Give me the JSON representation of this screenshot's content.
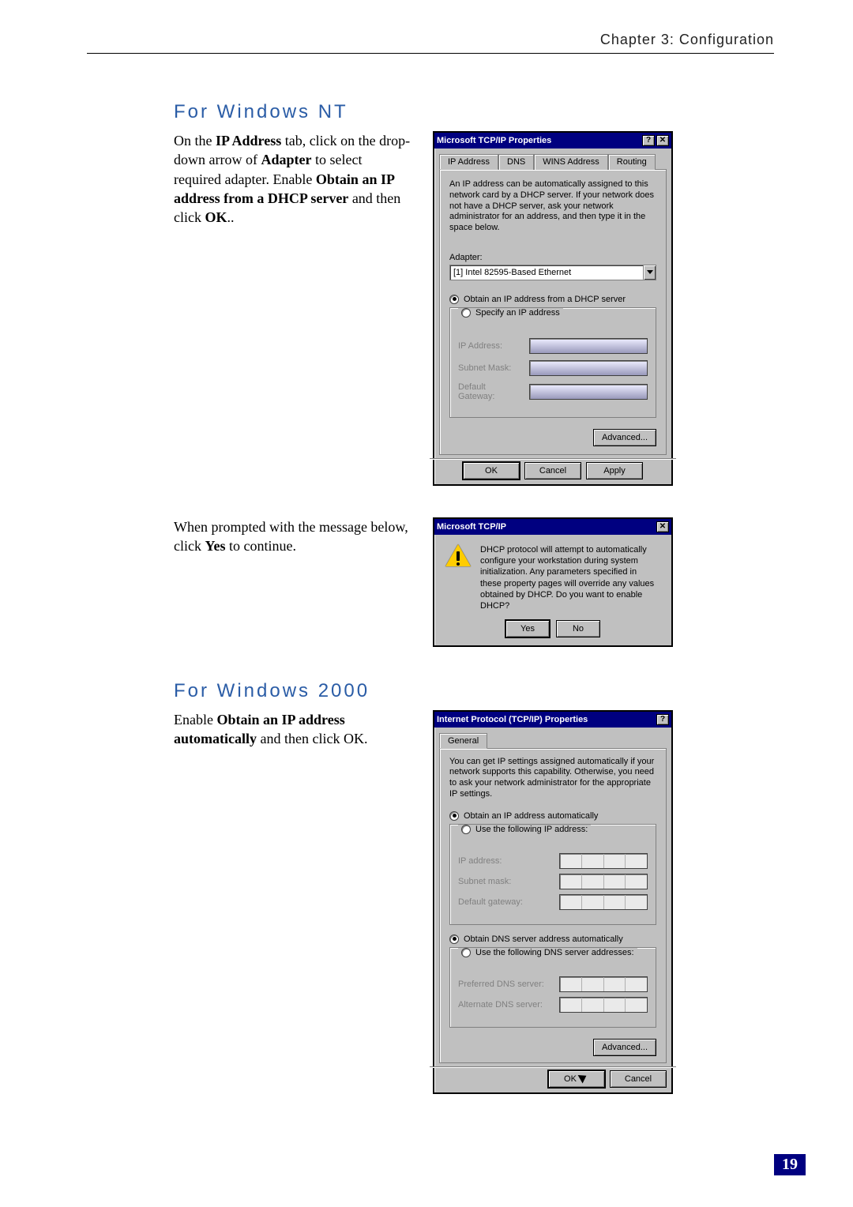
{
  "header": "Chapter 3: Configuration",
  "page_number": "19",
  "winnt": {
    "heading": "For Windows NT",
    "body": {
      "p1a": "On the ",
      "p1b": "IP Address",
      "p1c": " tab, click on the drop-down arrow of ",
      "p1d": "Adapter",
      "p1e": " to select required adapter. Enable ",
      "p1f": "Obtain an IP address from a DHCP server",
      "p1g": " and then click ",
      "p1h": "OK",
      "p1i": ".."
    },
    "dialog": {
      "title": "Microsoft TCP/IP Properties",
      "tabs": {
        "ip": "IP Address",
        "dns": "DNS",
        "wins": "WINS Address",
        "routing": "Routing"
      },
      "desc": "An IP address can be automatically assigned to this network card by a DHCP server. If your network does not have a DHCP server, ask your network administrator for an address, and then type it in the space below.",
      "adapter_label": "Adapter:",
      "adapter_value": "[1] Intel 82595-Based Ethernet",
      "opt_dhcp": "Obtain an IP address from a DHCP server",
      "opt_specify": "Specify an IP address",
      "ip_label": "IP Address:",
      "mask_label": "Subnet Mask:",
      "gw_label": "Default Gateway:",
      "advanced": "Advanced...",
      "ok": "OK",
      "cancel": "Cancel",
      "apply": "Apply"
    },
    "prompt_intro_a": "When prompted with the message below, click ",
    "prompt_intro_b": "Yes",
    "prompt_intro_c": " to continue.",
    "prompt": {
      "title": "Microsoft TCP/IP",
      "text": "DHCP protocol will attempt to automatically configure your workstation during system initialization. Any parameters specified in these property pages will override any values obtained by DHCP. Do you want to enable DHCP?",
      "yes": "Yes",
      "no": "No"
    }
  },
  "win2k": {
    "heading": "For Windows 2000",
    "body_a": "Enable ",
    "body_b": "Obtain an IP address automatically",
    "body_c": " and then click OK.",
    "dialog": {
      "title": "Internet Protocol (TCP/IP) Properties",
      "tab": "General",
      "desc": "You can get IP settings assigned automatically if your network supports this capability. Otherwise, you need to ask your network administrator for the appropriate IP settings.",
      "opt_auto_ip": "Obtain an IP address automatically",
      "opt_use_ip": "Use the following IP address:",
      "ip_label": "IP address:",
      "mask_label": "Subnet mask:",
      "gw_label": "Default gateway:",
      "opt_auto_dns": "Obtain DNS server address automatically",
      "opt_use_dns": "Use the following DNS server addresses:",
      "pref_dns": "Preferred DNS server:",
      "alt_dns": "Alternate DNS server:",
      "advanced": "Advanced...",
      "ok": "OK",
      "cancel": "Cancel"
    }
  }
}
